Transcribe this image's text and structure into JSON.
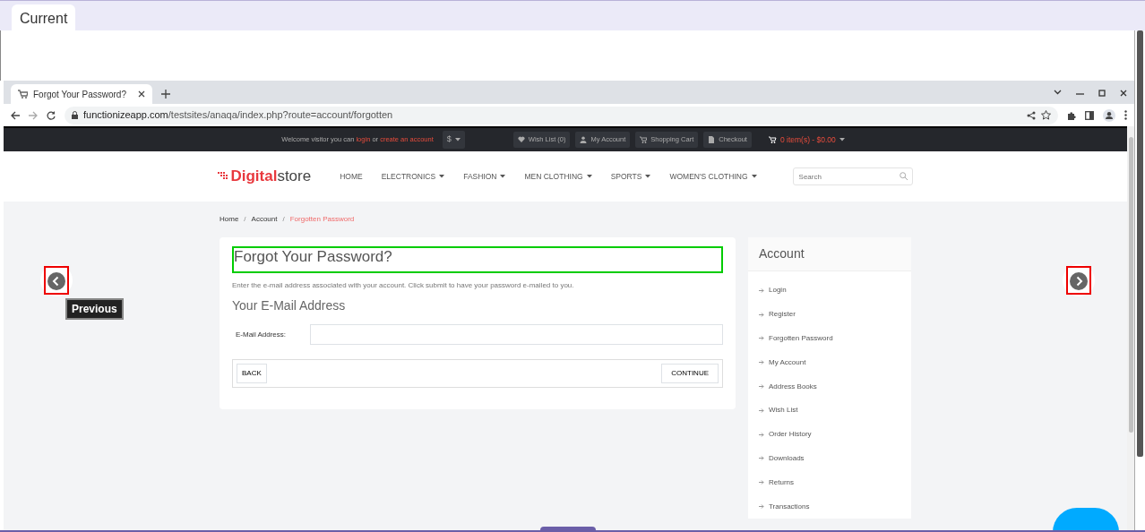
{
  "viewer": {
    "tab": "Current"
  },
  "browser": {
    "tab_title": "Forgot Your Password?",
    "url_host": "functionizeapp.com",
    "url_path": "/testsites/anaqa/index.php?route=account/forgotten"
  },
  "topbar": {
    "welcome": [
      {
        "kind": "text",
        "text": "Welcome visitor you can"
      },
      {
        "kind": "link",
        "text": "login"
      },
      {
        "kind": "text",
        "text": "or"
      },
      {
        "kind": "link",
        "text": "create an account"
      }
    ],
    "currency": "$",
    "links": [
      {
        "kind": "heart",
        "text": "Wish List (0)"
      },
      {
        "kind": "user",
        "text": "My Account"
      },
      {
        "kind": "cart",
        "text": "Shopping Cart"
      },
      {
        "kind": "file",
        "text": "Checkout"
      }
    ],
    "cart": "0 item(s) - $0.00"
  },
  "header": {
    "logo_bold": "Digital",
    "logo_light": "store",
    "nav": [
      {
        "label": "HOME",
        "dropdown": false
      },
      {
        "label": "ELECTRONICS",
        "dropdown": true
      },
      {
        "label": "FASHION",
        "dropdown": true
      },
      {
        "label": "MEN CLOTHING",
        "dropdown": true
      },
      {
        "label": "SPORTS",
        "dropdown": true
      },
      {
        "label": "WOMEN'S CLOTHING",
        "dropdown": true
      }
    ],
    "search": {
      "placeholder": "Search"
    }
  },
  "breadcrumb_separator": "/",
  "breadcrumb": [
    {
      "label": "Home",
      "current": false
    },
    {
      "label": "Account",
      "current": false
    },
    {
      "label": "Forgotten Password",
      "current": true
    }
  ],
  "form": {
    "title": "Forgot Your Password?",
    "title_highlighted": true,
    "intro": "Enter the e-mail address associated with your account. Click submit to have your password e-mailed to you.",
    "legend": "Your E-Mail Address",
    "field_label": "E-Mail Address:",
    "back": "BACK",
    "continue": "CONTINUE"
  },
  "sidebar": {
    "title": "Account",
    "items": [
      "Login",
      "Register",
      "Forgotten Password",
      "My Account",
      "Address Books",
      "Wish List",
      "Order History",
      "Downloads",
      "Returns",
      "Transactions"
    ]
  },
  "tooltip": "Previous"
}
